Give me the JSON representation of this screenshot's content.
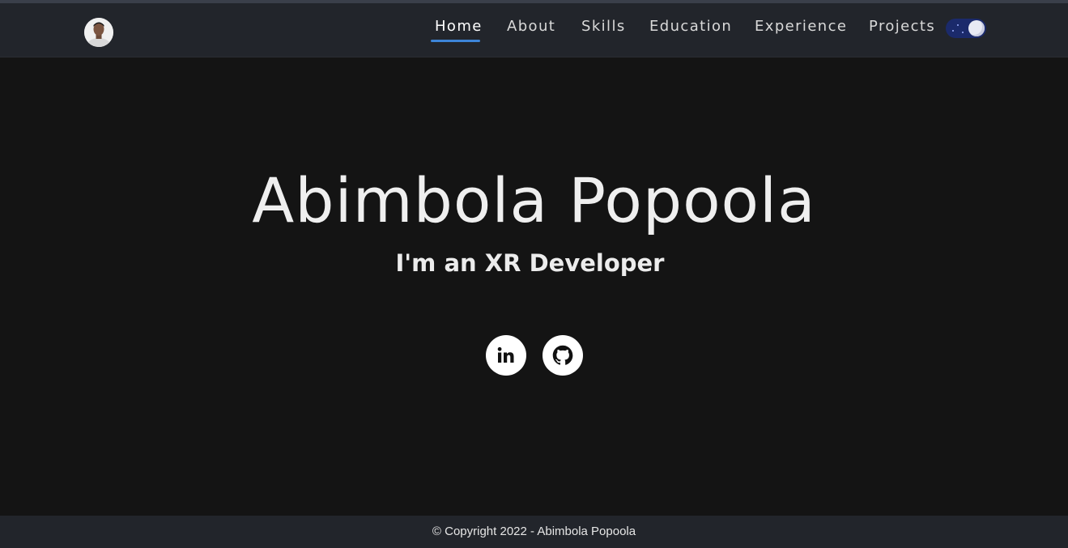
{
  "nav": {
    "links": [
      "Home",
      "About",
      "Skills",
      "Education",
      "Experience",
      "Projects"
    ],
    "active_index": 0,
    "theme_toggle": "dark-mode-toggle-icon"
  },
  "hero": {
    "name": "Abimbola Popoola",
    "subtitle": "I'm an XR Developer"
  },
  "social": {
    "icons": [
      "linkedin-icon",
      "github-icon"
    ]
  },
  "footer": {
    "copyright": "© Copyright 2022 - Abimbola Popoola"
  },
  "colors": {
    "background": "#141414",
    "navbar": "#22252b",
    "accent": "#3d85d8",
    "toggle": "#1b2a6b"
  }
}
